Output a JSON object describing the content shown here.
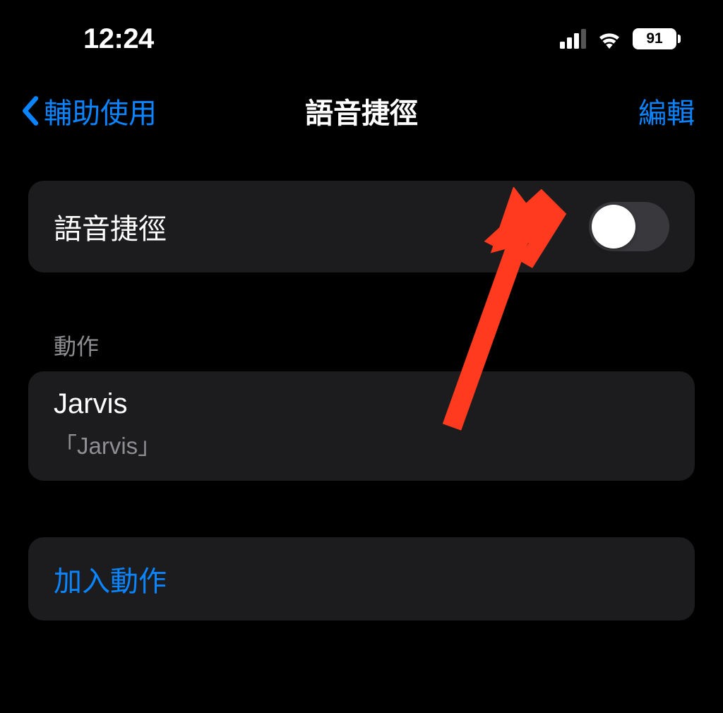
{
  "status": {
    "time": "12:24",
    "battery_pct": "91"
  },
  "nav": {
    "back_label": "輔助使用",
    "title": "語音捷徑",
    "edit_label": "編輯"
  },
  "toggle_row": {
    "label": "語音捷徑",
    "enabled": false
  },
  "actions_section": {
    "header": "動作",
    "items": [
      {
        "title": "Jarvis",
        "subtitle": "「Jarvis」"
      }
    ]
  },
  "add_action_label": "加入動作",
  "colors": {
    "accent": "#0a84ff",
    "cell_bg": "#1c1c1e",
    "muted": "#8e8e93",
    "annotation": "#ff3a1f"
  }
}
